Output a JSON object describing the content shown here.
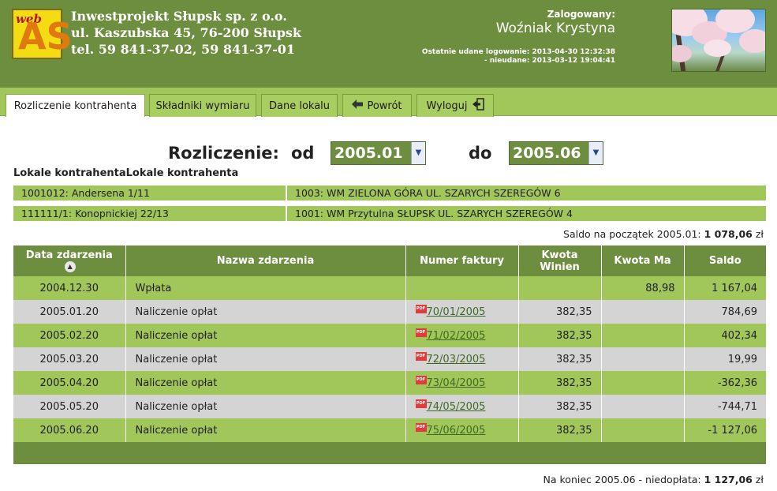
{
  "header": {
    "logo_text_web": "web",
    "logo_text_as": "AS",
    "company_line1": "Inwestprojekt Słupsk sp. z o.o.",
    "company_line2": "ul. Kaszubska 45, 76-200 Słupsk",
    "company_line3": "tel. 59 841-37-02, 59 841-37-01",
    "logged_label": "Zalogowany:",
    "user_name": "Woźniak Krystyna",
    "last_login_ok": "Ostatnie udane logowanie: 2013-04-30 12:32:38",
    "last_login_fail": "- nieudane: 2013-03-12 19:04:41"
  },
  "tabs": [
    {
      "label": "Rozliczenie kontrahenta",
      "active": true
    },
    {
      "label": "Składniki wymiaru"
    },
    {
      "label": "Dane lokalu"
    },
    {
      "label": "Powrót",
      "icon": "back-arrow-icon"
    },
    {
      "label": "Wyloguj",
      "icon": "logout-icon"
    }
  ],
  "period": {
    "title": "Rozliczenie:",
    "from_label": "od",
    "from_value": "2005.01",
    "to_label": "do",
    "to_value": "2005.06"
  },
  "premises": {
    "heading": "Lokale kontrahentaLokale kontrahenta",
    "rows": [
      {
        "local": "1001012: Andersena 1/11",
        "building": "1003: WM ZIELONA GÓRA UL. SZARYCH SZEREGÓW 6"
      },
      {
        "local": "111111/1: Konopnickiej 22/13",
        "building": "1001: WM Przytulna SŁUPSK UL. SZARYCH SZEREGÓW 4"
      }
    ]
  },
  "saldo_start": {
    "label": "Saldo na początek 2005.01:",
    "value": "1 078,06",
    "unit": "zł"
  },
  "table": {
    "headers": [
      "Data zdarzenia",
      "Nazwa zdarzenia",
      "Numer faktury",
      "Kwota Winien",
      "Kwota Ma",
      "Saldo"
    ],
    "pdf_badge": "PDF",
    "rows": [
      {
        "date": "2004.12.30",
        "name": "Wpłata",
        "invoice": "",
        "debit": "",
        "credit": "88,98",
        "balance": "1 167,04"
      },
      {
        "date": "2005.01.20",
        "name": "Naliczenie opłat",
        "invoice": "70/01/2005",
        "debit": "382,35",
        "credit": "",
        "balance": "784,69"
      },
      {
        "date": "2005.02.20",
        "name": "Naliczenie opłat",
        "invoice": "71/02/2005",
        "debit": "382,35",
        "credit": "",
        "balance": "402,34"
      },
      {
        "date": "2005.03.20",
        "name": "Naliczenie opłat",
        "invoice": "72/03/2005",
        "debit": "382,35",
        "credit": "",
        "balance": "19,99"
      },
      {
        "date": "2005.04.20",
        "name": "Naliczenie opłat",
        "invoice": "73/04/2005",
        "debit": "382,35",
        "credit": "",
        "balance": "-362,36"
      },
      {
        "date": "2005.05.20",
        "name": "Naliczenie opłat",
        "invoice": "74/05/2005",
        "debit": "382,35",
        "credit": "",
        "balance": "-744,71"
      },
      {
        "date": "2005.06.20",
        "name": "Naliczenie opłat",
        "invoice": "75/06/2005",
        "debit": "382,35",
        "credit": "",
        "balance": "-1 127,06"
      }
    ]
  },
  "saldo_end": {
    "label": "Na koniec 2005.06 - niedopłata:",
    "value": "1 127,06",
    "unit": "zł"
  },
  "colors": {
    "header_green": "#6e8e3f",
    "light_green": "#a1c65a",
    "row_gray": "#d4d4d4"
  }
}
